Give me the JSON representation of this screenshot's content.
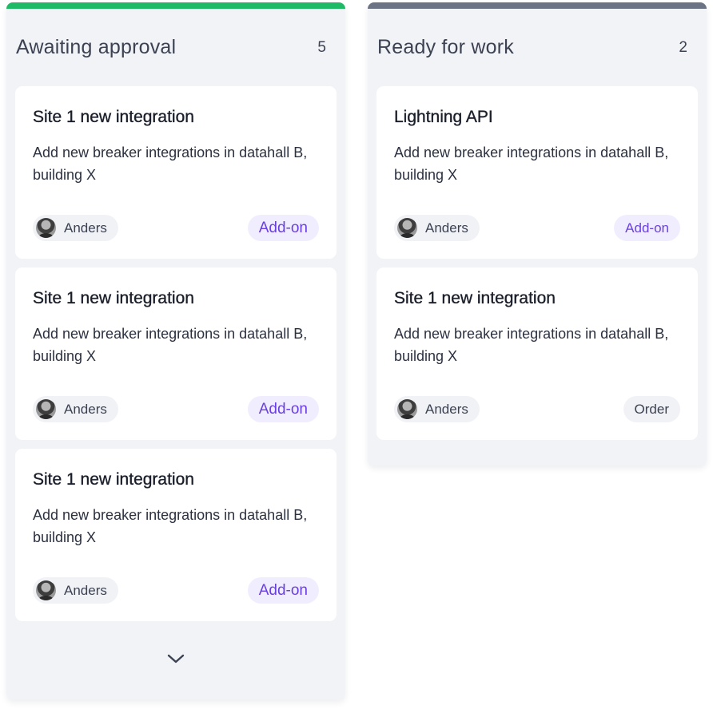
{
  "colors": {
    "awaiting_bar": "#1fba66",
    "ready_bar": "#6b7385",
    "addon_text": "#6a3fe0",
    "addon_bg": "#f0eefe"
  },
  "columns": [
    {
      "title": "Awaiting approval",
      "count": "5",
      "cards": [
        {
          "title": "Site 1 new integration",
          "description": "Add new breaker integrations in datahall B, building X",
          "assignee": "Anders",
          "tag": "Add-on"
        },
        {
          "title": "Site 1 new integration",
          "description": "Add new breaker integrations in datahall B, building X",
          "assignee": "Anders",
          "tag": "Add-on"
        },
        {
          "title": "Site 1 new integration",
          "description": "Add new breaker integrations in datahall B, building X",
          "assignee": "Anders",
          "tag": "Add-on"
        }
      ],
      "expand_icon": "chevron-down-icon"
    },
    {
      "title": "Ready for work",
      "count": "2",
      "cards": [
        {
          "title": "Lightning API",
          "description": "Add new breaker integrations in datahall B, building X",
          "assignee": "Anders",
          "tag": "Add-on"
        },
        {
          "title": "Site 1 new integration",
          "description": "Add new breaker integrations in datahall B, building X",
          "assignee": "Anders",
          "tag": "Order"
        }
      ]
    }
  ]
}
